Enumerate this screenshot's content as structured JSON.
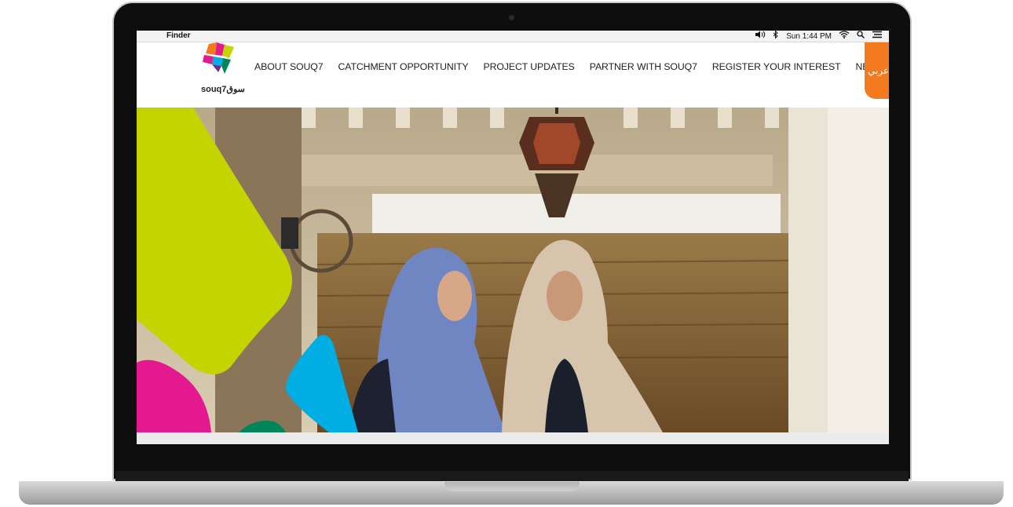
{
  "menubar": {
    "apple_icon": "apple-icon",
    "app_name": "Finder",
    "status": {
      "volume_icon": "volume-icon",
      "bluetooth_icon": "bluetooth-icon",
      "datetime": "Sun 1:44 PM",
      "wifi_icon": "wifi-icon",
      "search_icon": "search-icon",
      "list_icon": "list-icon"
    }
  },
  "header": {
    "logo_text": "souq7سوق",
    "nav": [
      {
        "label": "ABOUT SOUQ7"
      },
      {
        "label": "CATCHMENT OPPORTUNITY"
      },
      {
        "label": "PROJECT UPDATES"
      },
      {
        "label": "PARTNER WITH SOUQ7"
      },
      {
        "label": "REGISTER YOUR INTEREST"
      },
      {
        "label": "NEWS & MEDIA"
      }
    ],
    "language_toggle": "عربي"
  },
  "colors": {
    "accent_orange": "#f47a20",
    "shape_lime": "#c3d400",
    "shape_magenta": "#e4198f",
    "shape_cyan": "#00aee3",
    "shape_green": "#00845a"
  }
}
